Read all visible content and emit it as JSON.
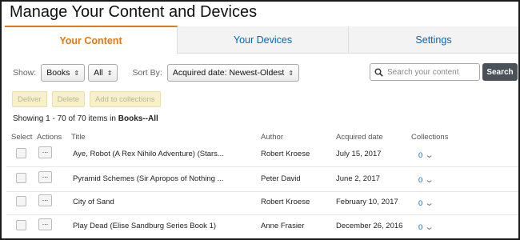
{
  "page": {
    "title": "Manage Your Content and Devices"
  },
  "tabs": [
    {
      "label": "Your Content",
      "active": true
    },
    {
      "label": "Your Devices",
      "active": false
    },
    {
      "label": "Settings",
      "active": false
    }
  ],
  "filters": {
    "show_label": "Show:",
    "show_type": "Books",
    "show_subset": "All",
    "sort_label": "Sort By:",
    "sort_value": "Acquired date: Newest-Oldest"
  },
  "search": {
    "placeholder": "Search your content",
    "button_label": "Search"
  },
  "actions": {
    "deliver": "Deliver",
    "delete": "Delete",
    "add_to_collections": "Add to collections"
  },
  "summary": {
    "prefix": "Showing 1 - 70 of 70 items in ",
    "scope": "Books--All"
  },
  "table": {
    "headers": {
      "select": "Select",
      "actions": "Actions",
      "title": "Title",
      "author": "Author",
      "acquired": "Acquired date",
      "collections": "Collections"
    },
    "rows": [
      {
        "title": "Aye, Robot (A Rex Nihilo Adventure) (Stars...",
        "author": "Robert Kroese",
        "date": "July 15, 2017",
        "collections": "0",
        "actions": "..."
      },
      {
        "title": "Pyramid Schemes (Sir Apropos of Nothing ...",
        "author": "Peter David",
        "date": "June 2, 2017",
        "collections": "0",
        "actions": "..."
      },
      {
        "title": "City of Sand",
        "author": "Robert Kroese",
        "date": "February 10, 2017",
        "collections": "0",
        "actions": "..."
      },
      {
        "title": "Play Dead (Elise Sandburg Series Book 1)",
        "author": "Anne Frasier",
        "date": "December 26, 2016",
        "collections": "0",
        "actions": "..."
      }
    ]
  },
  "colors": {
    "accent": "#e47911",
    "link": "#0066c0",
    "search_button": "#4a5159"
  }
}
